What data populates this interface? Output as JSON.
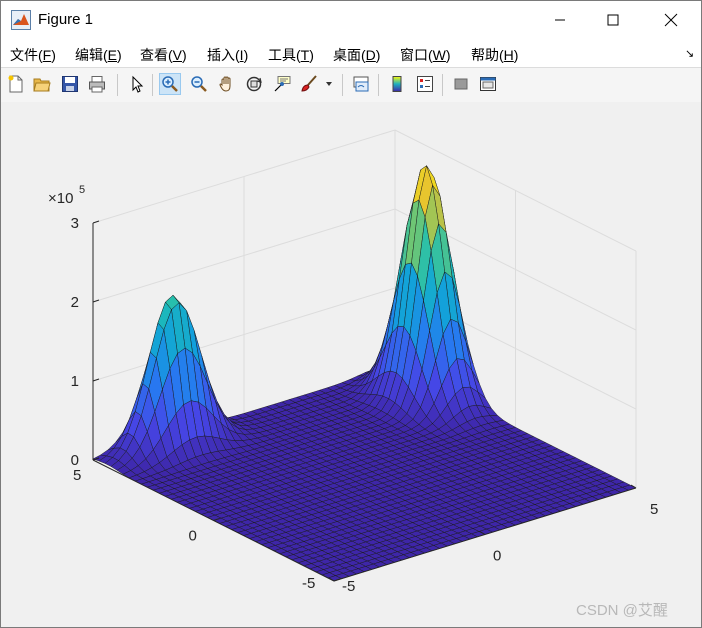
{
  "window": {
    "title": "Figure 1",
    "controls": [
      "minimize",
      "maximize",
      "close"
    ]
  },
  "menubar": {
    "items": [
      {
        "label": "文件(",
        "acc": "F",
        "tail": ")"
      },
      {
        "label": "编辑(",
        "acc": "E",
        "tail": ")"
      },
      {
        "label": "查看(",
        "acc": "V",
        "tail": ")"
      },
      {
        "label": "插入(",
        "acc": "I",
        "tail": ")"
      },
      {
        "label": "工具(",
        "acc": "T",
        "tail": ")"
      },
      {
        "label": "桌面(",
        "acc": "D",
        "tail": ")"
      },
      {
        "label": "窗口(",
        "acc": "W",
        "tail": ")"
      },
      {
        "label": "帮助(",
        "acc": "H",
        "tail": ")"
      }
    ]
  },
  "toolbar": {
    "buttons": [
      "new-figure",
      "open-file",
      "save",
      "print",
      "edit-plot-pointer",
      "zoom-in",
      "zoom-out",
      "pan",
      "rotate-3d",
      "data-cursor",
      "brush",
      "link-plot",
      "insert-colorbar",
      "insert-legend",
      "hide-plot-tools",
      "show-plot-tools"
    ],
    "active": "zoom-in"
  },
  "plot": {
    "exponent_label": "×10",
    "exponent_power": "5",
    "z_ticks": [
      "0",
      "1",
      "2",
      "3"
    ],
    "left_axis_ticks": [
      "5",
      "0",
      "-5"
    ],
    "right_axis_ticks": [
      "-5",
      "0",
      "5"
    ],
    "colormap": "parula"
  },
  "chart_data": {
    "type": "surface",
    "title": "",
    "z_axis": {
      "ticks": [
        0,
        1,
        2,
        3
      ],
      "range": [
        0,
        3
      ],
      "exponent": 5
    },
    "left_axis": {
      "ticks": [
        5,
        0,
        -5
      ],
      "range": [
        -5,
        5
      ]
    },
    "right_axis": {
      "ticks": [
        -5,
        0,
        5
      ],
      "range": [
        -5,
        5
      ]
    },
    "peaks": [
      {
        "location": "left corner",
        "max": 195000
      },
      {
        "location": "right corner",
        "max": 300000
      }
    ],
    "colormap": "parula",
    "grid": true
  },
  "watermark": "CSDN @艾醒"
}
